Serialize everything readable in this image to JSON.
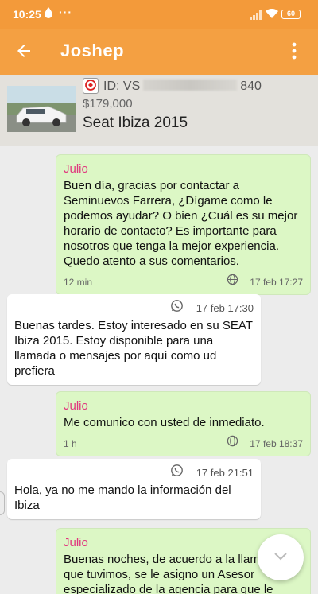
{
  "status_bar": {
    "time": "10:25",
    "dots": "···",
    "battery": "60"
  },
  "app_bar": {
    "title": "Joshep"
  },
  "listing": {
    "id_prefix": "ID: VS",
    "id_suffix": "840",
    "price": "$179,000",
    "name": "Seat Ibiza 2015"
  },
  "messages": [
    {
      "direction": "out",
      "sender": "Julio",
      "text": "Buen día, gracias por contactar a Seminuevos Farrera,  ¿Dígame como le podemos ayudar? O bien ¿Cuál es su mejor horario de contacto? Es importante para nosotros que tenga la mejor experiencia. Quedo atento a sus comentarios.",
      "ago": "12 min",
      "time": "17 feb 17:27"
    },
    {
      "direction": "in",
      "text": "Buenas tardes. Estoy interesado en su SEAT Ibiza 2015. Estoy disponible para una llamada o mensajes por aquí como ud prefiera",
      "time": "17 feb 17:30"
    },
    {
      "direction": "out",
      "sender": "Julio",
      "text": "Me comunico con usted de inmediato.",
      "ago": "1 h",
      "time": "17 feb 18:37"
    },
    {
      "direction": "in",
      "text": "Hola, ya no me mando la información del Ibiza",
      "time": "17 feb 21:51"
    },
    {
      "direction": "out",
      "sender": "Julio",
      "text": "Buenas noches, de acuerdo a la llamada que tuvimos, se le asigno un Asesor especializado de la agencia para que le diera"
    }
  ],
  "colors": {
    "status_bar": "#f39a3a",
    "app_bar": "#f4a042",
    "sender": "#e0357d",
    "outgoing_bubble": "#dcf7c5"
  }
}
